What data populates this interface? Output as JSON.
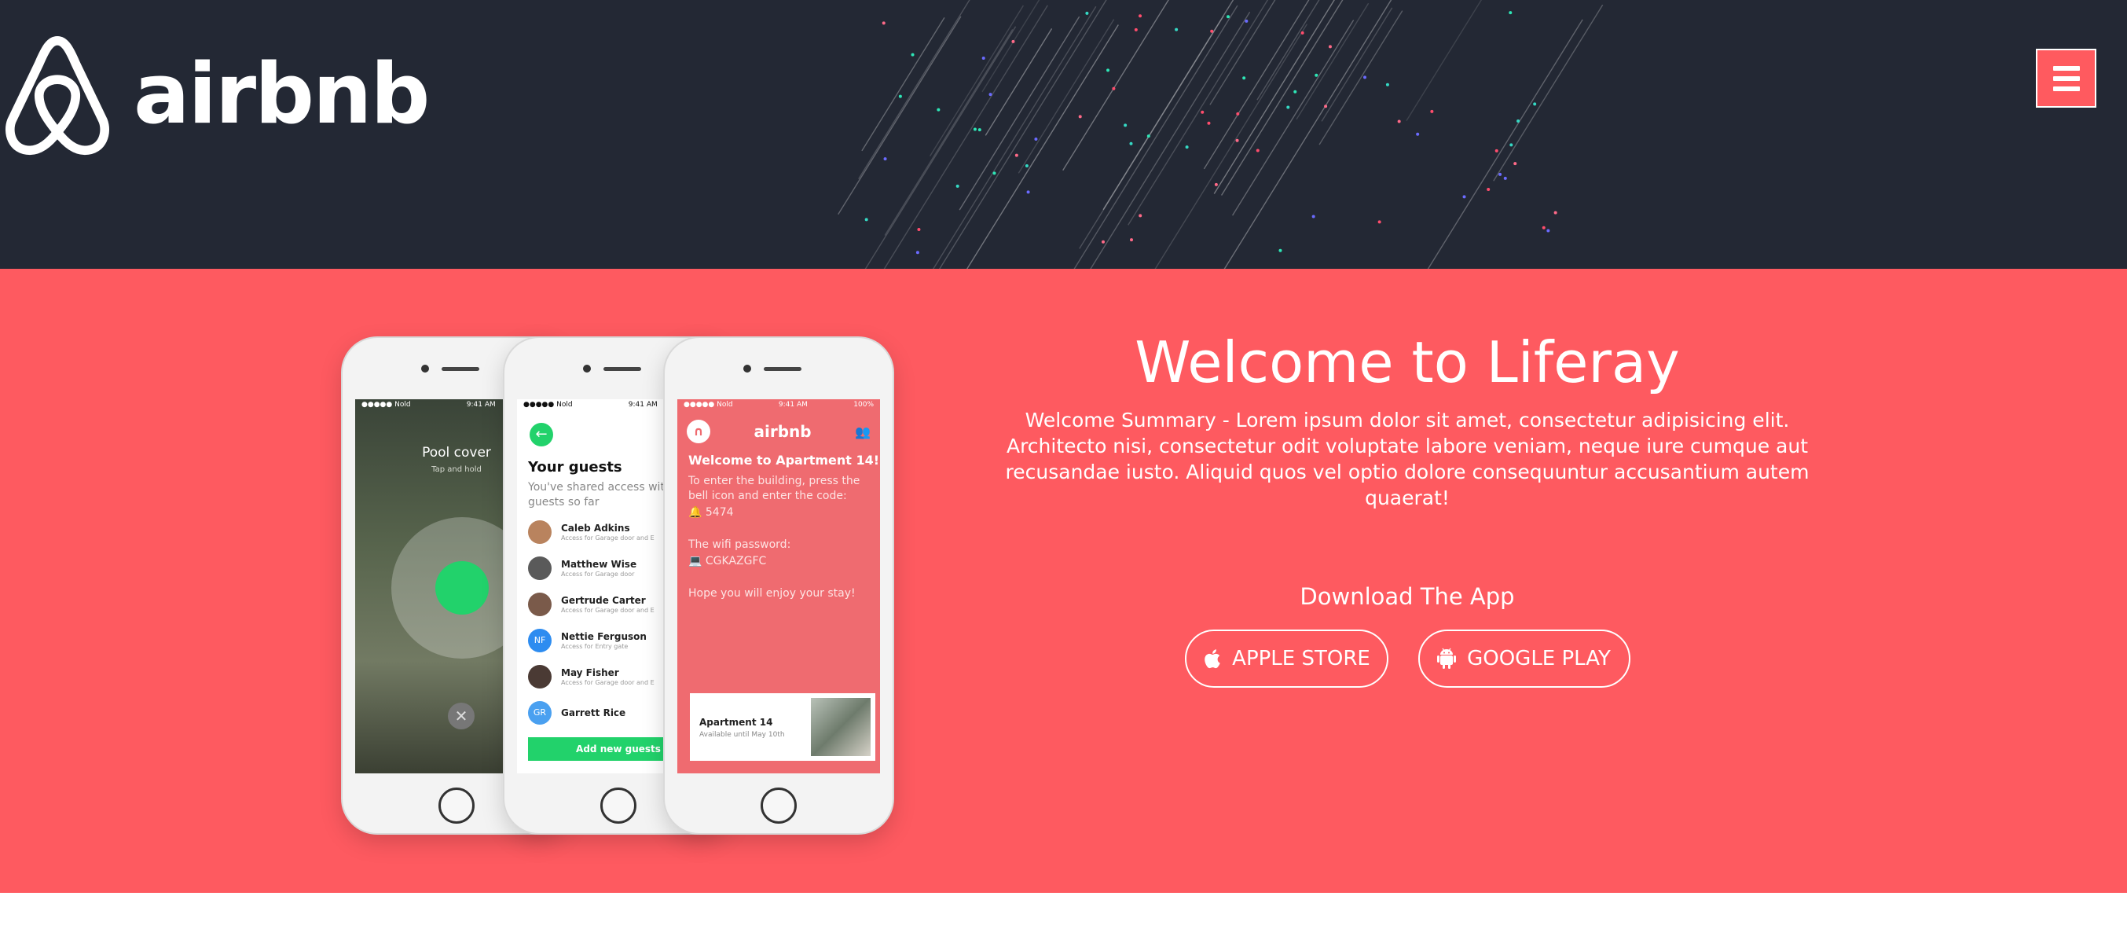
{
  "header": {
    "brand_name": "airbnb",
    "menu_icon": "hamburger-menu-icon",
    "colors": {
      "background": "#232834",
      "accent": "#ff5a5f"
    }
  },
  "hero": {
    "background_color": "#fe5a60",
    "title": "Welcome to Liferay",
    "summary": "Welcome Summary - Lorem ipsum dolor sit amet, consectetur adipisicing elit. Architecto nisi, consectetur odit voluptate labore veniam, neque iure cumque aut recusandae iusto. Aliquid quos vel optio dolore consequuntur accusantium autem quaerat!",
    "download_heading": "Download The App",
    "buttons": {
      "apple": {
        "label": "APPLE STORE",
        "icon": "apple-icon"
      },
      "google": {
        "label": "GOOGLE PLAY",
        "icon": "android-icon"
      }
    }
  },
  "phones": {
    "phone1": {
      "status_carrier": "●●●●● Nold",
      "status_time": "9:41 AM",
      "title": "Pool cover",
      "subtitle": "Tap and hold"
    },
    "phone2": {
      "status_carrier": "●●●●● Nold",
      "status_time": "9:41 AM",
      "title": "Your guests",
      "subtitle": "You've shared access with 6 guests so far",
      "guests": [
        {
          "name": "Caleb Adkins",
          "detail": "Access for Garage door and E"
        },
        {
          "name": "Matthew Wise",
          "detail": "Access for Garage door"
        },
        {
          "name": "Gertrude Carter",
          "detail": "Access for Garage door and E"
        },
        {
          "name": "Nettie Ferguson",
          "detail": "Access for Entry gate",
          "initials": "NF"
        },
        {
          "name": "May Fisher",
          "detail": "Access for Garage door and E"
        },
        {
          "name": "Garrett Rice",
          "detail": "",
          "initials": "GR"
        }
      ],
      "add_button": "Add new guests"
    },
    "phone3": {
      "status_carrier": "●●●●● Nold",
      "status_time": "9:41 AM",
      "status_battery": "100%",
      "brand": "airbnb",
      "title": "Welcome to Apartment 14!",
      "instructions": "To enter the building, press the bell icon and enter the code:",
      "code": "5474",
      "wifi_label": "The wifi password:",
      "wifi_password": "CGKAZGFC",
      "closing": "Hope you will enjoy your stay!",
      "card_title": "Apartment 14",
      "card_subtitle": "Available until May 10th"
    }
  }
}
